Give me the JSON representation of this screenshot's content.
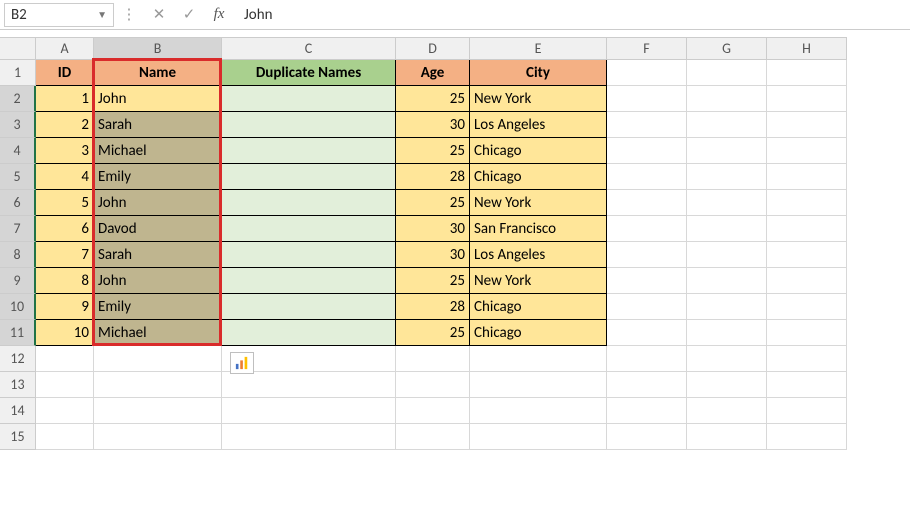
{
  "formula_bar": {
    "name_box": "B2",
    "value": "John"
  },
  "columns": [
    "A",
    "B",
    "C",
    "D",
    "E",
    "F",
    "G",
    "H"
  ],
  "selected_col": "B",
  "row_count": 15,
  "selected_rows": [
    2,
    3,
    4,
    5,
    6,
    7,
    8,
    9,
    10,
    11
  ],
  "headers": {
    "A": "ID",
    "B": "Name",
    "C": "Duplicate Names",
    "D": "Age",
    "E": "City"
  },
  "rows": [
    {
      "id": 1,
      "name": "John",
      "dup": "",
      "age": 25,
      "city": "New York"
    },
    {
      "id": 2,
      "name": "Sarah",
      "dup": "",
      "age": 30,
      "city": "Los Angeles"
    },
    {
      "id": 3,
      "name": "Michael",
      "dup": "",
      "age": 25,
      "city": "Chicago"
    },
    {
      "id": 4,
      "name": "Emily",
      "dup": "",
      "age": 28,
      "city": "Chicago"
    },
    {
      "id": 5,
      "name": "John",
      "dup": "",
      "age": 25,
      "city": "New York"
    },
    {
      "id": 6,
      "name": "Davod",
      "dup": "",
      "age": 30,
      "city": "San Francisco"
    },
    {
      "id": 7,
      "name": "Sarah",
      "dup": "",
      "age": 30,
      "city": "Los Angeles"
    },
    {
      "id": 8,
      "name": "John",
      "dup": "",
      "age": 25,
      "city": "New York"
    },
    {
      "id": 9,
      "name": "Emily",
      "dup": "",
      "age": 28,
      "city": "Chicago"
    },
    {
      "id": 10,
      "name": "Michael",
      "dup": "",
      "age": 25,
      "city": "Chicago"
    }
  ],
  "active_cell": "B2",
  "qa_label": "Quick Analysis"
}
